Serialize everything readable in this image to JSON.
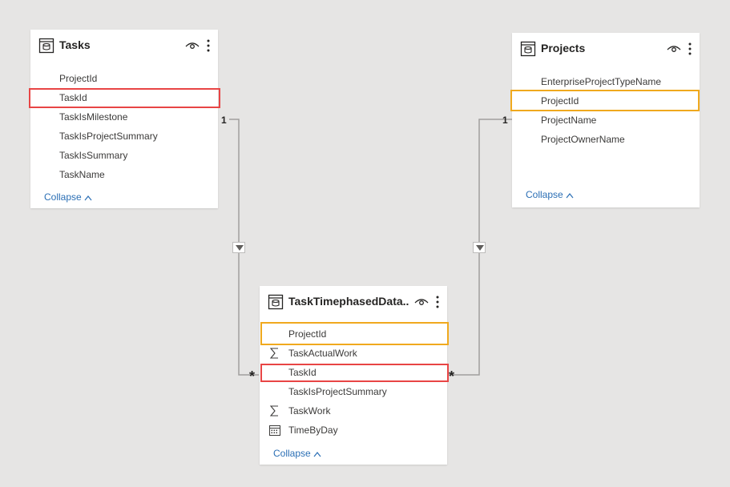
{
  "tables": {
    "tasks": {
      "title": "Tasks",
      "fields": [
        "ProjectId",
        "TaskId",
        "TaskIsMilestone",
        "TaskIsProjectSummary",
        "TaskIsSummary",
        "TaskName"
      ],
      "collapse_label": "Collapse"
    },
    "projects": {
      "title": "Projects",
      "fields": [
        "EnterpriseProjectTypeName",
        "ProjectId",
        "ProjectName",
        "ProjectOwnerName"
      ],
      "collapse_label": "Collapse"
    },
    "ttd": {
      "title": "TaskTimephasedData...",
      "fields": [
        {
          "name": "ProjectId",
          "icon": ""
        },
        {
          "name": "TaskActualWork",
          "icon": "sigma-icon"
        },
        {
          "name": "TaskId",
          "icon": ""
        },
        {
          "name": "TaskIsProjectSummary",
          "icon": ""
        },
        {
          "name": "TaskWork",
          "icon": "sigma-icon"
        },
        {
          "name": "TimeByDay",
          "icon": "calendar-icon"
        }
      ],
      "collapse_label": "Collapse"
    }
  },
  "relationships": {
    "tasks_to_ttd": {
      "from_cardinality": "1",
      "to_cardinality": "*"
    },
    "projects_to_ttd": {
      "from_cardinality": "1",
      "to_cardinality": "*"
    }
  },
  "colors": {
    "task_key_highlight": "#e84545",
    "project_key_highlight": "#f0a91e",
    "link": "#2b6fb5"
  }
}
